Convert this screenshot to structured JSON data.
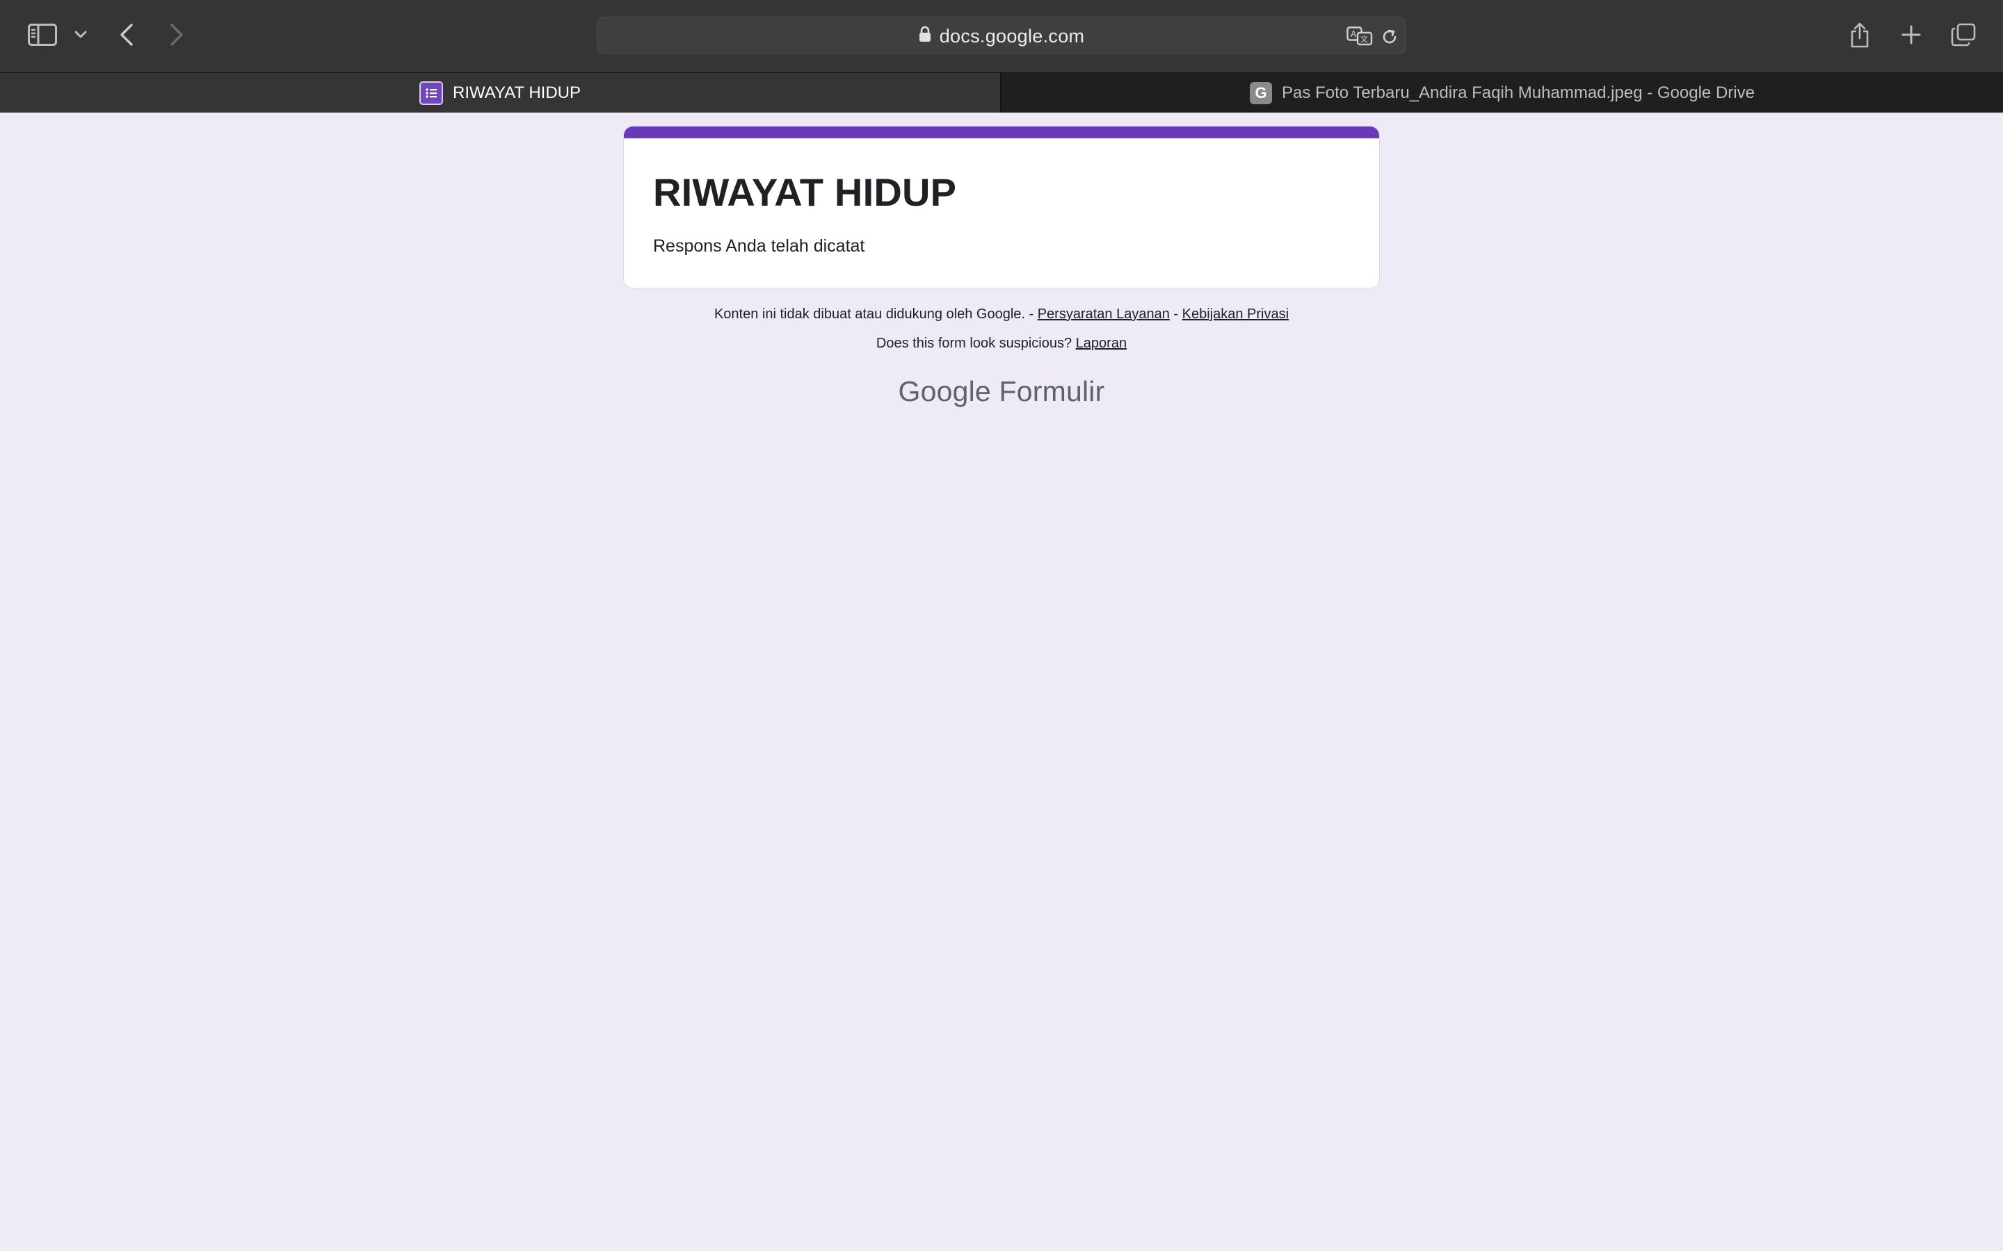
{
  "browser": {
    "url": "docs.google.com",
    "tabs": [
      {
        "label": "RIWAYAT HIDUP",
        "active": true,
        "favicon": "google-forms-icon"
      },
      {
        "label": "Pas Foto Terbaru_Andira Faqih Muhammad.jpeg - Google Drive",
        "active": false,
        "favicon": "G"
      }
    ]
  },
  "form": {
    "title": "RIWAYAT HIDUP",
    "message": "Respons Anda telah dicatat",
    "accent_color": "#673ab7"
  },
  "footer": {
    "disclaimer": "Konten ini tidak dibuat atau didukung oleh Google. - ",
    "terms_link": "Persyaratan Layanan",
    "separator": " - ",
    "privacy_link": "Kebijakan Privasi",
    "suspicious_text": "Does this form look suspicious? ",
    "report_link": "Laporan",
    "brand_google": "Google",
    "brand_product": "Formulir"
  }
}
